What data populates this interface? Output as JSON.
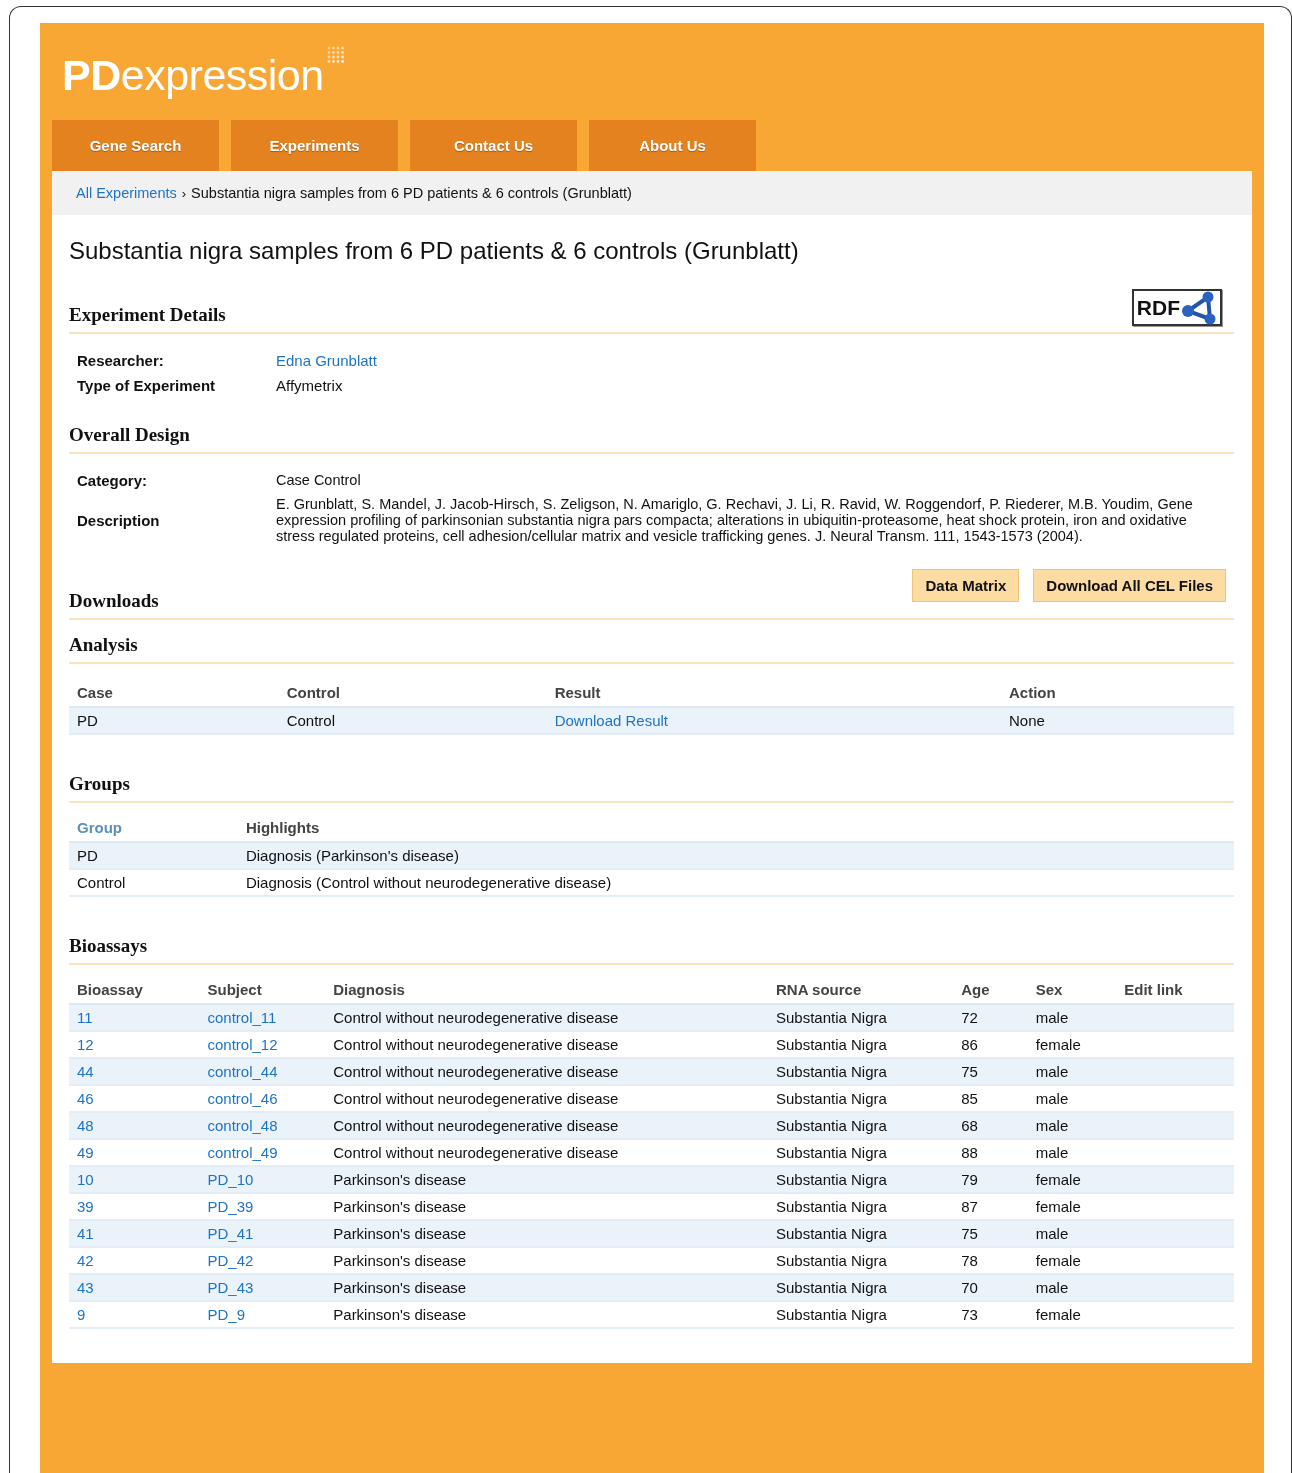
{
  "logo": "**PD**expression",
  "nav": [
    {
      "label": "Gene Search",
      "selected": false
    },
    {
      "label": "Experiments",
      "selected": false
    },
    {
      "label": "Contact Us",
      "selected": false
    },
    {
      "label": "About Us",
      "selected": false
    }
  ],
  "breadcrumb": {
    "link": "All Experiments",
    "separator": "›",
    "current": "Substantia nigra samples from 6 PD patients & 6 controls (Grunblatt)"
  },
  "title": "Substantia nigra samples from 6 PD patients & 6 controls (Grunblatt)",
  "experiment_details": {
    "heading": "Experiment Details",
    "badge": "RDF",
    "fields": [
      {
        "label": "Researcher:",
        "value": "Edna Grunblatt",
        "kind": "link"
      },
      {
        "label": "Type of Experiment",
        "value": "Affymetrix",
        "kind": "text"
      }
    ]
  },
  "overall_design": {
    "heading": "Overall Design",
    "fields": [
      {
        "label": "Category:",
        "value": "Case Control"
      },
      {
        "label": "Description",
        "value": "E. Grunblatt, S. Mandel, J. Jacob-Hirsch, S. Zeligson, N. Amariglo, G. Rechavi, J. Li, R. Ravid, W. Roggendorf, P. Riederer, M.B. Youdim, Gene expression profiling of parkinsonian substantia nigra pars compacta; alterations in ubiquitin-proteasome, heat shock protein, iron and oxidative stress regulated proteins, cell adhesion/cellular matrix and vesicle trafficking genes. J. Neural Transm. 111, 1543-1573 (2004)."
      }
    ]
  },
  "downloads": {
    "heading": "Downloads",
    "buttons": [
      "Data Matrix",
      "Download All CEL Files"
    ]
  },
  "analysis": {
    "heading": "Analysis",
    "columns": [
      "Case",
      "Control",
      "Result",
      "Action"
    ],
    "rows": [
      {
        "case": "PD",
        "control": "Control",
        "result": "Download Result",
        "action": "None"
      }
    ]
  },
  "groups": {
    "heading": "Groups",
    "columns": [
      {
        "label": "Group",
        "kind": "link"
      },
      {
        "label": "Highlights",
        "kind": "text"
      }
    ],
    "rows": [
      {
        "group": "PD",
        "highlights": "Diagnosis (Parkinson's disease)"
      },
      {
        "group": "Control",
        "highlights": "Diagnosis (Control without neurodegenerative disease)"
      }
    ]
  },
  "bioassays": {
    "heading": "Bioassays",
    "columns": [
      "Bioassay",
      "Subject",
      "Diagnosis",
      "RNA source",
      "Age",
      "Sex",
      "Edit link"
    ],
    "rows": [
      {
        "bioassay": "11",
        "subject": "control_11",
        "diagnosis": "Control without neurodegenerative disease",
        "rna_source": "Substantia Nigra",
        "age": "72",
        "sex": "male"
      },
      {
        "bioassay": "12",
        "subject": "control_12",
        "diagnosis": "Control without neurodegenerative disease",
        "rna_source": "Substantia Nigra",
        "age": "86",
        "sex": "female"
      },
      {
        "bioassay": "44",
        "subject": "control_44",
        "diagnosis": "Control without neurodegenerative disease",
        "rna_source": "Substantia Nigra",
        "age": "75",
        "sex": "male"
      },
      {
        "bioassay": "46",
        "subject": "control_46",
        "diagnosis": "Control without neurodegenerative disease",
        "rna_source": "Substantia Nigra",
        "age": "85",
        "sex": "male"
      },
      {
        "bioassay": "48",
        "subject": "control_48",
        "diagnosis": "Control without neurodegenerative disease",
        "rna_source": "Substantia Nigra",
        "age": "68",
        "sex": "male"
      },
      {
        "bioassay": "49",
        "subject": "control_49",
        "diagnosis": "Control without neurodegenerative disease",
        "rna_source": "Substantia Nigra",
        "age": "88",
        "sex": "male"
      },
      {
        "bioassay": "10",
        "subject": "PD_10",
        "diagnosis": "Parkinson's disease",
        "rna_source": "Substantia Nigra",
        "age": "79",
        "sex": "female"
      },
      {
        "bioassay": "39",
        "subject": "PD_39",
        "diagnosis": "Parkinson's disease",
        "rna_source": "Substantia Nigra",
        "age": "87",
        "sex": "female"
      },
      {
        "bioassay": "41",
        "subject": "PD_41",
        "diagnosis": "Parkinson's disease",
        "rna_source": "Substantia Nigra",
        "age": "75",
        "sex": "male"
      },
      {
        "bioassay": "42",
        "subject": "PD_42",
        "diagnosis": "Parkinson's disease",
        "rna_source": "Substantia Nigra",
        "age": "78",
        "sex": "female"
      },
      {
        "bioassay": "43",
        "subject": "PD_43",
        "diagnosis": "Parkinson's disease",
        "rna_source": "Substantia Nigra",
        "age": "70",
        "sex": "male"
      },
      {
        "bioassay": "9",
        "subject": "PD_9",
        "diagnosis": "Parkinson's disease",
        "rna_source": "Substantia Nigra",
        "age": "73",
        "sex": "female"
      }
    ]
  }
}
